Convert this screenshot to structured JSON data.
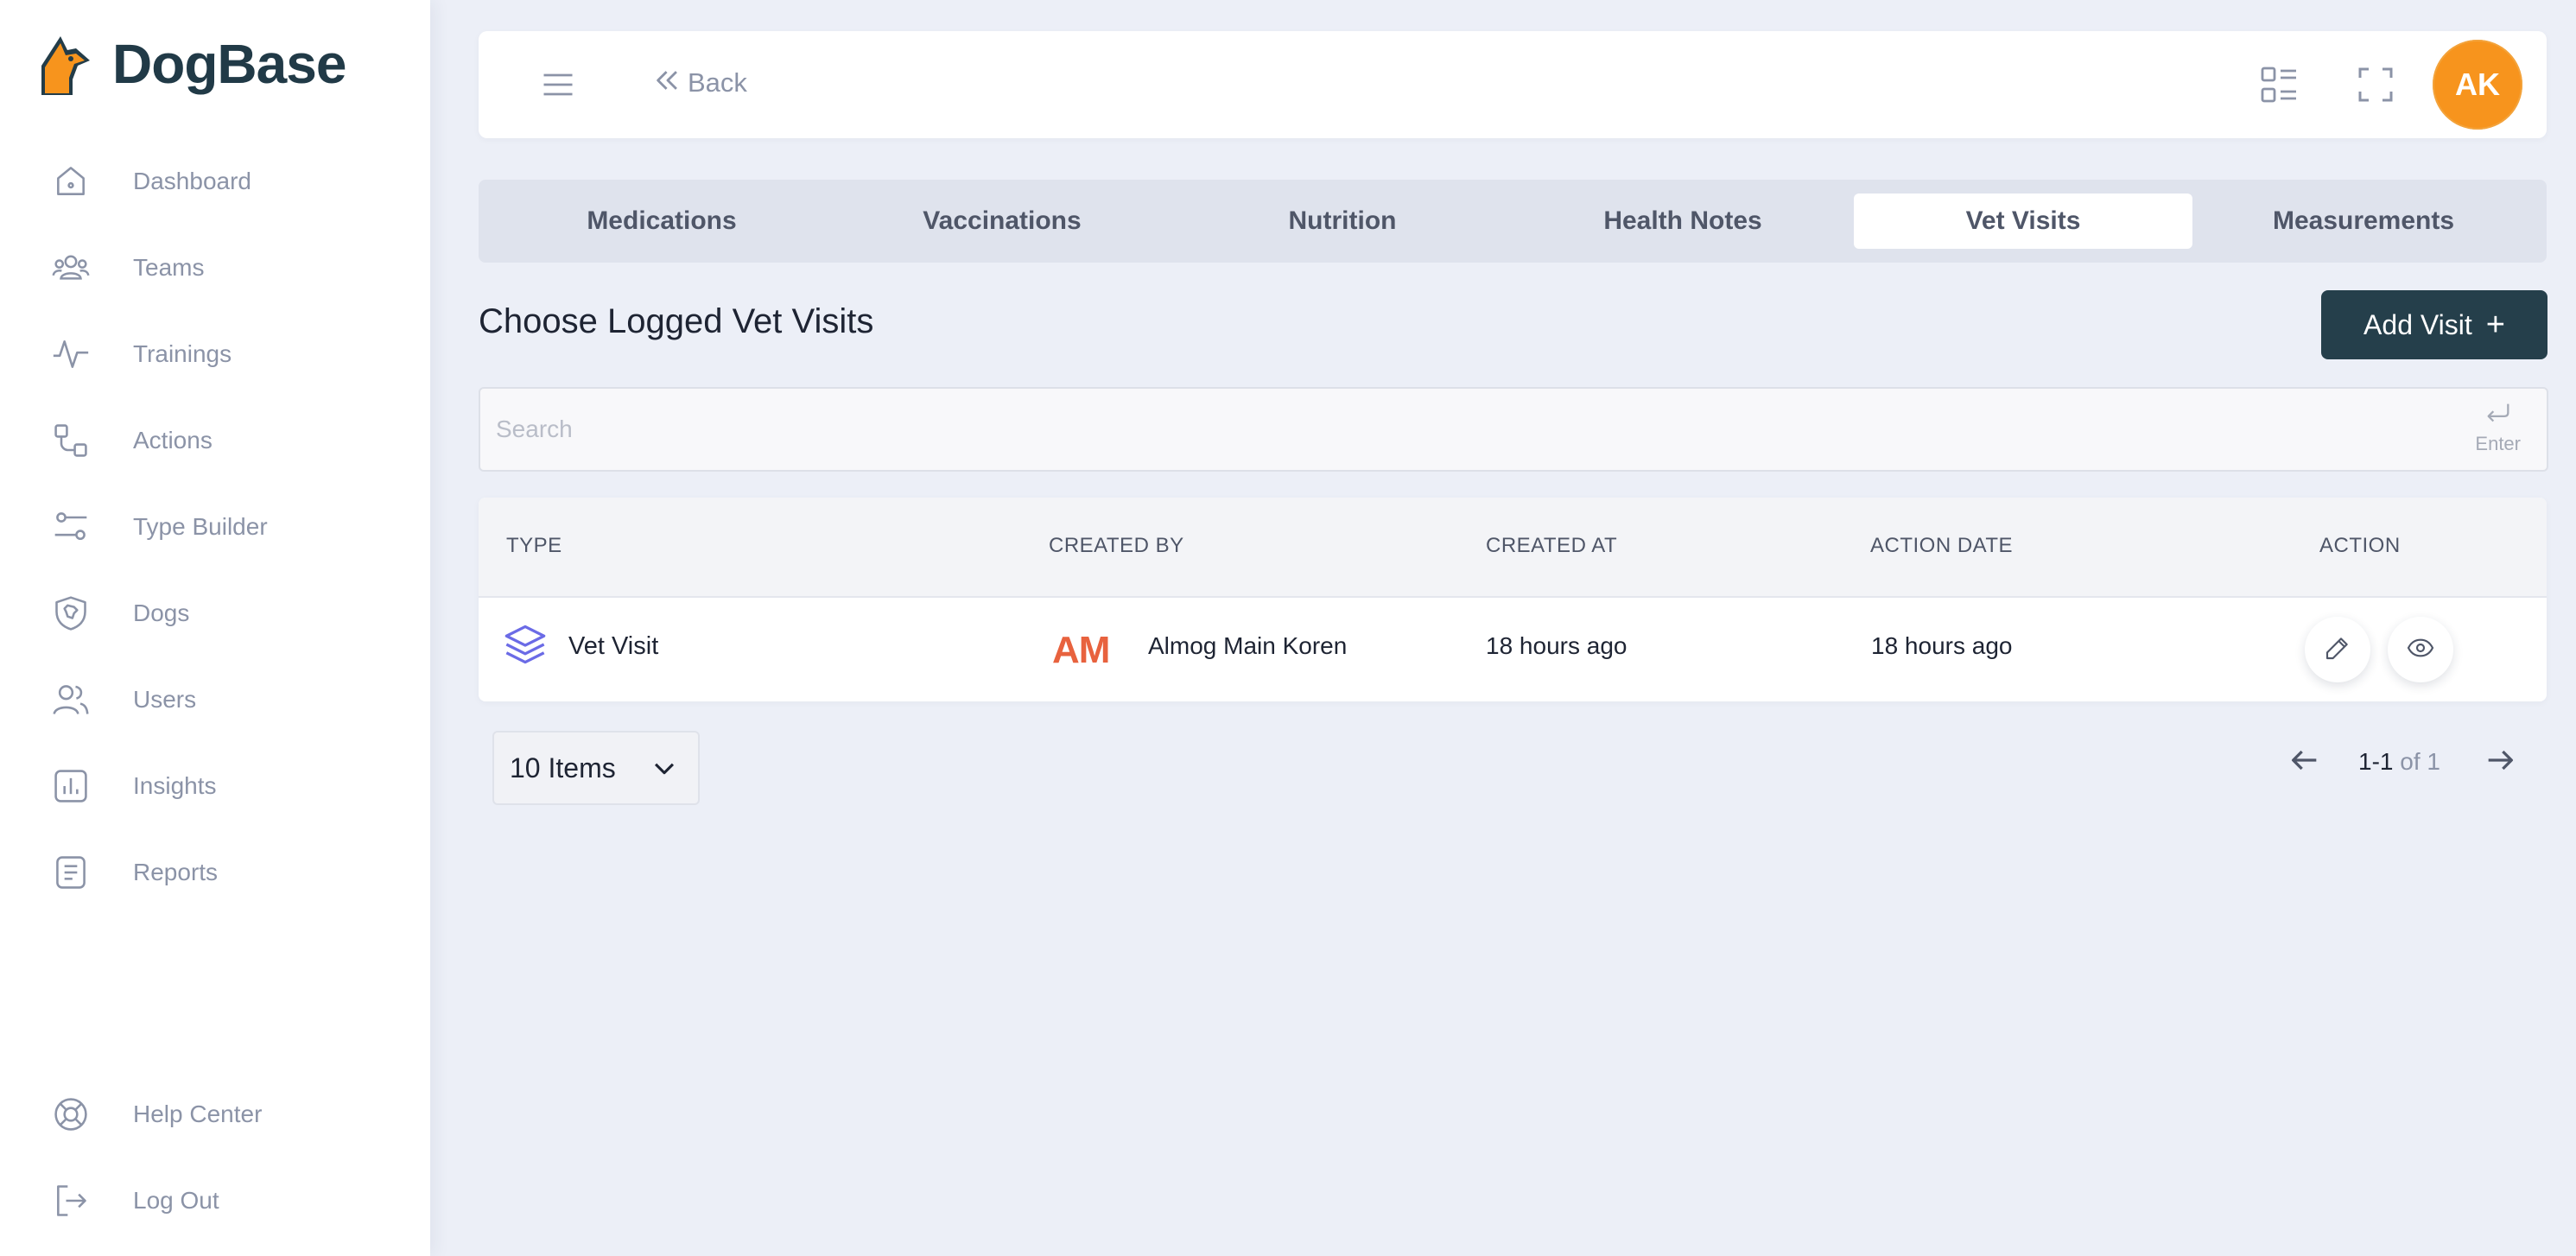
{
  "app": {
    "name": "DogBase"
  },
  "sidebar": {
    "items": [
      {
        "label": "Dashboard",
        "icon": "home-icon"
      },
      {
        "label": "Teams",
        "icon": "team-icon"
      },
      {
        "label": "Trainings",
        "icon": "activity-icon"
      },
      {
        "label": "Actions",
        "icon": "flow-icon"
      },
      {
        "label": "Type Builder",
        "icon": "sliders-icon"
      },
      {
        "label": "Dogs",
        "icon": "dog-shield-icon"
      },
      {
        "label": "Users",
        "icon": "users-icon"
      },
      {
        "label": "Insights",
        "icon": "chart-icon"
      },
      {
        "label": "Reports",
        "icon": "document-icon"
      }
    ],
    "footer": [
      {
        "label": "Help Center",
        "icon": "lifebuoy-icon"
      },
      {
        "label": "Log Out",
        "icon": "logout-icon"
      }
    ]
  },
  "header": {
    "back_label": "Back",
    "avatar_initials": "AK",
    "avatar_color": "#f7941d"
  },
  "tabs": [
    {
      "label": "Medications",
      "active": false
    },
    {
      "label": "Vaccinations",
      "active": false
    },
    {
      "label": "Nutrition",
      "active": false
    },
    {
      "label": "Health Notes",
      "active": false
    },
    {
      "label": "Vet Visits",
      "active": true
    },
    {
      "label": "Measurements",
      "active": false
    }
  ],
  "main": {
    "title": "Choose Logged Vet Visits",
    "add_button_label": "Add Visit",
    "add_button_plus": "+",
    "search": {
      "placeholder": "Search",
      "value": "",
      "hint": "Enter"
    }
  },
  "table": {
    "columns": [
      "TYPE",
      "CREATED BY",
      "CREATED AT",
      "ACTION DATE",
      "ACTION"
    ],
    "rows": [
      {
        "type": "Vet Visit",
        "creator_logo": "AM",
        "created_by": "Almog Main Koren",
        "created_at": "18 hours ago",
        "action_date": "18 hours ago"
      }
    ]
  },
  "pagination": {
    "page_size_label": "10 Items",
    "range": "1-1",
    "of_label": "of 1"
  },
  "colors": {
    "brand_dark": "#253f4b",
    "accent_orange": "#f7941d",
    "creator_logo": "#e8623e",
    "type_icon": "#6b6be6"
  }
}
